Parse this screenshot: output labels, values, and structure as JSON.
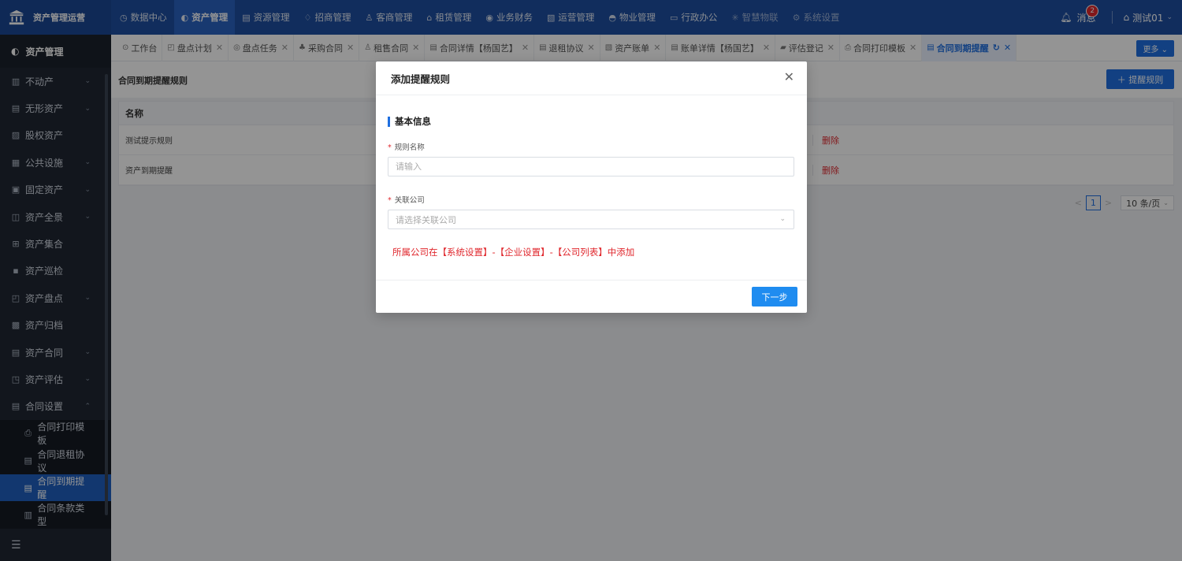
{
  "app": {
    "brand": "资产管理运营"
  },
  "topnav": [
    {
      "label": "数据中心",
      "icon": "◷",
      "active": false
    },
    {
      "label": "资产管理",
      "icon": "◐",
      "active": true
    },
    {
      "label": "资源管理",
      "icon": "▤",
      "active": false
    },
    {
      "label": "招商管理",
      "icon": "♢",
      "active": false
    },
    {
      "label": "客商管理",
      "icon": "♙",
      "active": false
    },
    {
      "label": "租赁管理",
      "icon": "⌂",
      "active": false
    },
    {
      "label": "业务财务",
      "icon": "◉",
      "active": false
    },
    {
      "label": "运营管理",
      "icon": "▧",
      "active": false
    },
    {
      "label": "物业管理",
      "icon": "◓",
      "active": false
    },
    {
      "label": "行政办公",
      "icon": "▭",
      "active": false
    },
    {
      "label": "智慧物联",
      "icon": "✳",
      "active": false
    },
    {
      "label": "系统设置",
      "icon": "⚙",
      "active": false
    }
  ],
  "top_right": {
    "messages_label": "消息",
    "messages_count": "2",
    "user_name": "测试01"
  },
  "sidebar": {
    "header": "资产管理",
    "items": [
      {
        "label": "不动产",
        "icon": "▥",
        "chev": "⌄"
      },
      {
        "label": "无形资产",
        "icon": "▤",
        "chev": "⌄"
      },
      {
        "label": "股权资产",
        "icon": "▨",
        "chev": ""
      },
      {
        "label": "公共设施",
        "icon": "▦",
        "chev": "⌄"
      },
      {
        "label": "固定资产",
        "icon": "▣",
        "chev": "⌄"
      },
      {
        "label": "资产全景",
        "icon": "◫",
        "chev": "⌄"
      },
      {
        "label": "资产集合",
        "icon": "⊞",
        "chev": ""
      },
      {
        "label": "资产巡检",
        "icon": "▪",
        "chev": ""
      },
      {
        "label": "资产盘点",
        "icon": "◰",
        "chev": "⌄"
      },
      {
        "label": "资产归档",
        "icon": "▩",
        "chev": ""
      },
      {
        "label": "资产合同",
        "icon": "▤",
        "chev": "⌄"
      },
      {
        "label": "资产评估",
        "icon": "◳",
        "chev": "⌄"
      },
      {
        "label": "合同设置",
        "icon": "▤",
        "chev": "⌃"
      }
    ],
    "sub_items": [
      {
        "label": "合同打印模板",
        "icon": "⎙",
        "active": false
      },
      {
        "label": "合同退租协议",
        "icon": "▤",
        "active": false
      },
      {
        "label": "合同到期提醒",
        "icon": "▤",
        "active": true
      },
      {
        "label": "合同条款类型",
        "icon": "▥",
        "active": false
      }
    ],
    "footer_icon": "☰"
  },
  "tabs": [
    {
      "label": "工作台",
      "icon": "⊙",
      "closable": false,
      "active": false
    },
    {
      "label": "盘点计划",
      "icon": "◰",
      "closable": true,
      "active": false
    },
    {
      "label": "盘点任务",
      "icon": "◎",
      "closable": true,
      "active": false
    },
    {
      "label": "采购合同",
      "icon": "♣",
      "closable": true,
      "active": false
    },
    {
      "label": "租售合同",
      "icon": "♙",
      "closable": true,
      "active": false
    },
    {
      "label": "合同详情【杨国艺】",
      "icon": "▤",
      "closable": true,
      "active": false
    },
    {
      "label": "退租协议",
      "icon": "▤",
      "closable": true,
      "active": false
    },
    {
      "label": "资产账单",
      "icon": "▧",
      "closable": true,
      "active": false
    },
    {
      "label": "账单详情【杨国艺】",
      "icon": "▤",
      "closable": true,
      "active": false
    },
    {
      "label": "评估登记",
      "icon": "▰",
      "closable": true,
      "active": false
    },
    {
      "label": "合同打印模板",
      "icon": "⎙",
      "closable": true,
      "active": false
    },
    {
      "label": "合同到期提醒",
      "icon": "▤",
      "closable": true,
      "active": true
    }
  ],
  "tabs_more": "更多",
  "tab_refresh_icon": "↻",
  "page": {
    "title": "合同到期提醒规则",
    "add_button": "＋ 提醒规则",
    "table": {
      "header": "名称",
      "rows": [
        {
          "name": "测试提示规则",
          "action": "删除"
        },
        {
          "name": "资产到期提醒",
          "action": "删除"
        }
      ]
    },
    "pagination": {
      "prev": "<",
      "current": "1",
      "next": ">",
      "page_size": "10 条/页"
    }
  },
  "modal": {
    "title": "添加提醒规则",
    "close_icon": "✕",
    "section_title": "基本信息",
    "field_name_label": "规则名称",
    "field_name_placeholder": "请输入",
    "field_company_label": "关联公司",
    "field_company_placeholder": "请选择关联公司",
    "hint": "所属公司在【系统设置】-【企业设置】-【公司列表】中添加",
    "next_button": "下一步"
  }
}
